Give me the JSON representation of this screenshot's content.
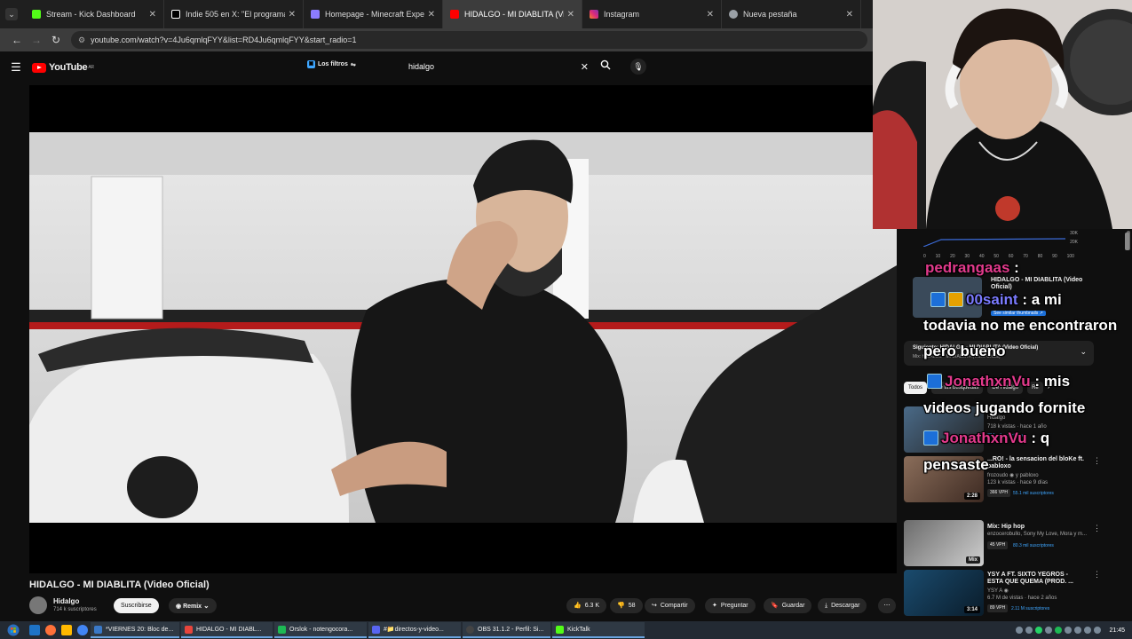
{
  "browser": {
    "tabs": [
      {
        "label": "Stream - Kick Dashboard",
        "color": "#53fc18"
      },
      {
        "label": "Indie 505 en X: \"El programado",
        "color": "#ffffff"
      },
      {
        "label": "Homepage - Minecraft Experien",
        "color": "#8c7cff"
      },
      {
        "label": "HIDALGO - MI DIABLITA (Video",
        "color": "#ff0000"
      },
      {
        "label": "Instagram",
        "color": "#d6249f"
      },
      {
        "label": "Nueva pestaña",
        "color": "#9aa0a6"
      }
    ],
    "url": "youtube.com/watch?v=4Ju6qmlqFYY&list=RD4Ju6qmlqFYY&start_radio=1"
  },
  "youtube": {
    "logo": "YouTube",
    "region": "AR",
    "filters_label": "Los filtros",
    "search_value": "hidalgo"
  },
  "video": {
    "title": "HIDALGO - MI DIABLITA (Video Oficial)",
    "channel": "Hidalgo",
    "subscribers": "714 k suscriptores",
    "subscribe_label": "Suscribirse",
    "remix_label": "Remix",
    "likes": "6.3 K",
    "dislikes": "58",
    "share_label": "Compartir",
    "ask_label": "Preguntar",
    "save_label": "Guardar",
    "download_label": "Descargar"
  },
  "graph": {
    "ticks": [
      "0",
      "10",
      "20",
      "30",
      "40",
      "50",
      "60",
      "70",
      "80",
      "90",
      "100"
    ],
    "ylabels": [
      "30K",
      "20K"
    ]
  },
  "sidebar": {
    "now_title": "HIDALGO - MI DIABLITA (Video Oficial)",
    "similar_label": "See similar thumbnails ↗",
    "queue_line1": "Siguiente: HIDALGO - MI DIABLITA (Video Oficial)",
    "queue_line2": "Mix: HIDALGO - MI DIABLITA (Video Oficial)",
    "chips": [
      "Todos",
      "De tus búsquedas",
      "De Hidalgo",
      "Re"
    ],
    "recos": [
      {
        "title": "",
        "channel": "Hidalgo",
        "meta": "718 k vistas · hace 1 año",
        "badge": "",
        "badge2": "714 mil suscriptores",
        "duration": ""
      },
      {
        "title": "...RO! - la sensacion del bloKe ft. pabloxo",
        "channel": "frozoudo ◉ y pabloxo",
        "meta": "123 k vistas · hace 9 días",
        "badge": "366 VPH",
        "badge2": "55.1 mil suscriptores",
        "duration": "2:28"
      },
      {
        "title": "Mix: Hip hop",
        "channel": "enzocerobullo, Sony My Love, Mora y m...",
        "meta": "",
        "badge": "45 VPH",
        "badge2": "80.3 mil suscriptores",
        "duration": "Mix"
      },
      {
        "title": "YSY A FT. SIXTO YEGROS - ESTA QUE QUEMA (PROD. ...",
        "channel": "YSY A ◉",
        "meta": "6.7 M de vistas · hace 2 años",
        "badge": "89 VPH",
        "badge2": "2.11 M suscriptores",
        "duration": "3:14"
      }
    ]
  },
  "kick_chat": [
    {
      "user": "pedrangaas",
      "text": ""
    },
    {
      "user": "00saint",
      "text": ": a mi"
    },
    {
      "user": "",
      "text": "todavia no me encontraron"
    },
    {
      "user": "",
      "text": "pero bueno"
    },
    {
      "user": "JonathxnVu",
      "text": ": mis"
    },
    {
      "user": "",
      "text": "videos jugando fornite"
    },
    {
      "user": "JonathxnVu",
      "text": ": q"
    },
    {
      "user": "",
      "text": "pensaste"
    }
  ],
  "taskbar": {
    "apps": [
      {
        "label": "*VIERNES 20: Bloc de...",
        "color": "#3a79c8"
      },
      {
        "label": "HIDALGO - MI DIABL...",
        "color": "#e8453c"
      },
      {
        "label": "Orslok - notengocora...",
        "color": "#1db954"
      },
      {
        "label": "#📁directos-y-video...",
        "color": "#5865f2"
      },
      {
        "label": "OBS 31.1.2 - Perfil: Si...",
        "color": "#444444"
      },
      {
        "label": "KickTalk",
        "color": "#53fc18"
      }
    ],
    "time": "21:45"
  }
}
